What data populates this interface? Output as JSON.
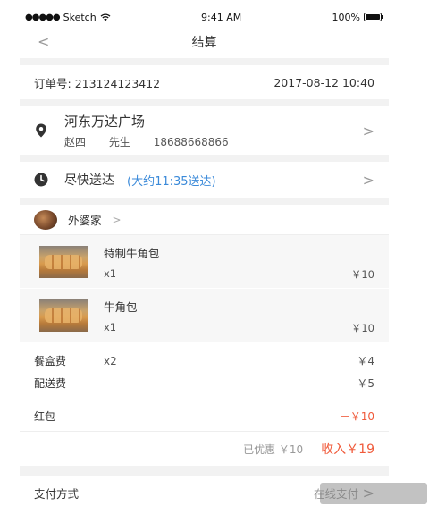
{
  "status_bar": {
    "carrier": "Sketch",
    "time": "9:41 AM",
    "battery": "100%"
  },
  "nav": {
    "title": "结算",
    "back_glyph": "<"
  },
  "order": {
    "label": "订单号:",
    "number": "213124123412",
    "datetime": "2017-08-12 10:40"
  },
  "address": {
    "name": "河东万达广场",
    "contact_name": "赵四",
    "title": "先生",
    "phone": "18688668866",
    "icon": "location-pin-icon"
  },
  "delivery": {
    "label": "尽快送达",
    "estimate": "(大约11:35送达)",
    "icon": "clock-icon"
  },
  "shop": {
    "name": "外婆家"
  },
  "items": [
    {
      "name": "特制牛角包",
      "qty": "x1",
      "price": "￥10"
    },
    {
      "name": "牛角包",
      "qty": "x1",
      "price": "￥10"
    }
  ],
  "fees": [
    {
      "label": "餐盒费",
      "qty": "x2",
      "amount": "￥4"
    },
    {
      "label": "配送费",
      "qty": "",
      "amount": "￥5"
    }
  ],
  "red_packet": {
    "label": "红包",
    "amount": "－￥10"
  },
  "totals": {
    "discount": "已优惠 ￥10",
    "income": "收入￥19"
  },
  "payment": {
    "label": "支付方式",
    "value": "在线支付"
  },
  "colors": {
    "accent_blue": "#3b8ad9",
    "accent_red": "#f05a3a",
    "background": "#f2f2f2"
  }
}
